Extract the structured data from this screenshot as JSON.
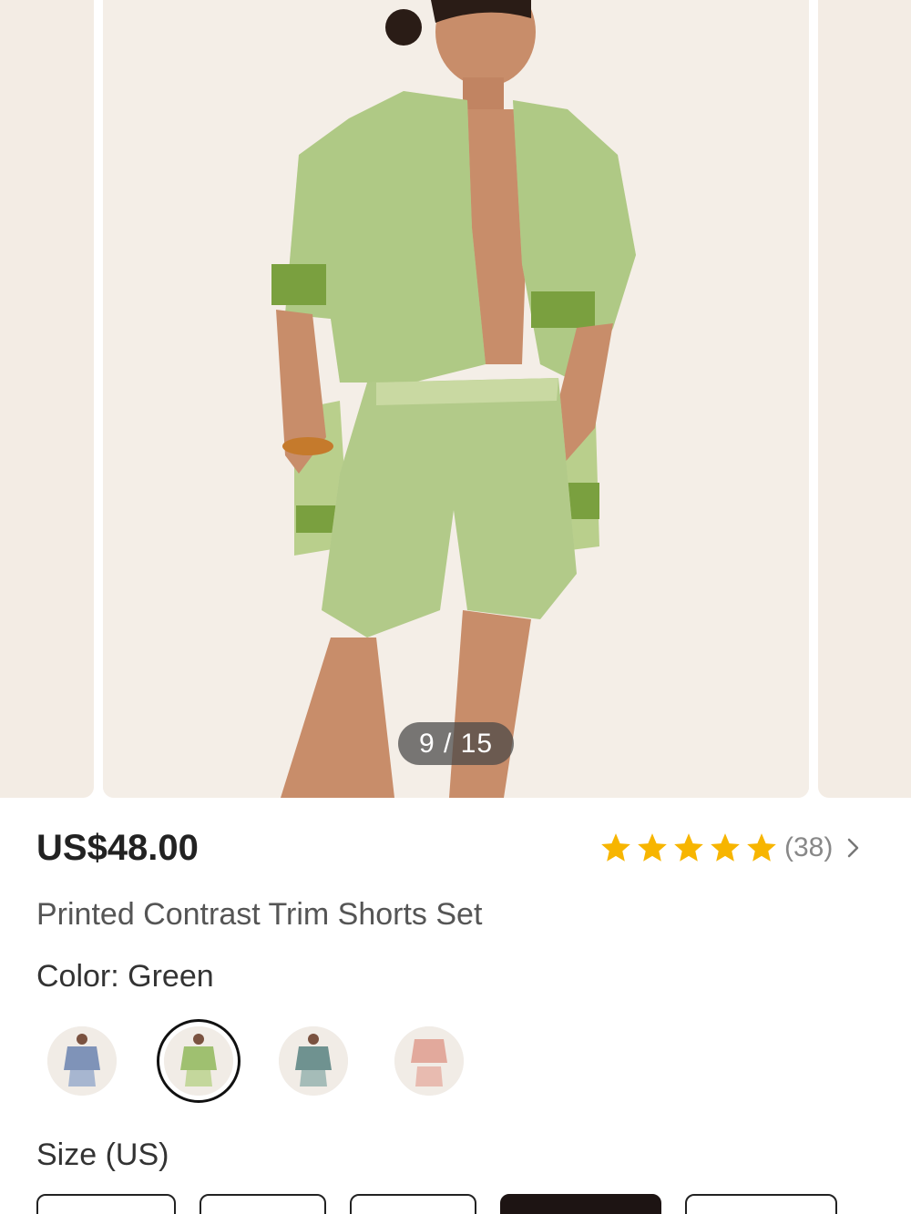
{
  "gallery": {
    "counter": "9 / 15"
  },
  "product": {
    "price": "US$48.00",
    "title": "Printed Contrast Trim Shorts Set",
    "rating": {
      "stars": 5,
      "count": "(38)",
      "star_color": "#f7b500"
    }
  },
  "color": {
    "label": "Color: Green",
    "swatches": [
      {
        "name": "blue",
        "selected": false
      },
      {
        "name": "green",
        "selected": true
      },
      {
        "name": "teal",
        "selected": false
      },
      {
        "name": "pink",
        "selected": false
      }
    ]
  },
  "size": {
    "label": "Size (US)"
  },
  "icons": {
    "star": "star-icon",
    "chevron": "chevron-right-icon"
  }
}
